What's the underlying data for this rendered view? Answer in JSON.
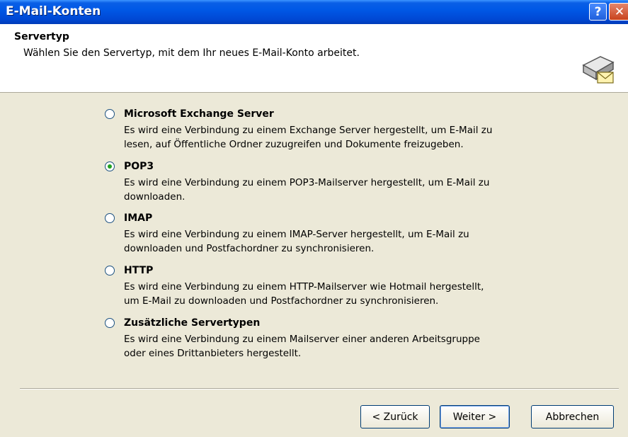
{
  "window": {
    "title": "E-Mail-Konten",
    "help_label": "?",
    "close_label": "✕"
  },
  "header": {
    "title": "Servertyp",
    "subtitle": "Wählen Sie den Servertyp, mit dem Ihr neues E-Mail-Konto arbeitet.",
    "icon": "mail-server-icon"
  },
  "options": [
    {
      "label": "Microsoft Exchange Server",
      "desc_line1": "Es wird eine Verbindung zu einem Exchange Server hergestellt, um E-Mail zu",
      "desc_line2": "lesen, auf Öffentliche Ordner zuzugreifen und Dokumente freizugeben.",
      "selected": false
    },
    {
      "label": "POP3",
      "desc_line1": "Es wird eine Verbindung zu einem POP3-Mailserver hergestellt, um E-Mail zu",
      "desc_line2": "downloaden.",
      "selected": true
    },
    {
      "label": "IMAP",
      "desc_line1": "Es wird eine Verbindung zu einem IMAP-Server hergestellt, um E-Mail zu",
      "desc_line2": "downloaden und Postfachordner zu synchronisieren.",
      "selected": false
    },
    {
      "label": "HTTP",
      "desc_line1": "Es wird eine Verbindung zu einem HTTP-Mailserver wie Hotmail hergestellt,",
      "desc_line2": "um E-Mail zu downloaden und Postfachordner zu synchronisieren.",
      "selected": false
    },
    {
      "label": "Zusätzliche Servertypen",
      "desc_line1": "Es wird eine Verbindung zu einem Mailserver einer anderen Arbeitsgruppe",
      "desc_line2": "oder eines Drittanbieters hergestellt.",
      "selected": false
    }
  ],
  "buttons": {
    "back": "< Zurück",
    "next": "Weiter >",
    "cancel": "Abbrechen"
  }
}
